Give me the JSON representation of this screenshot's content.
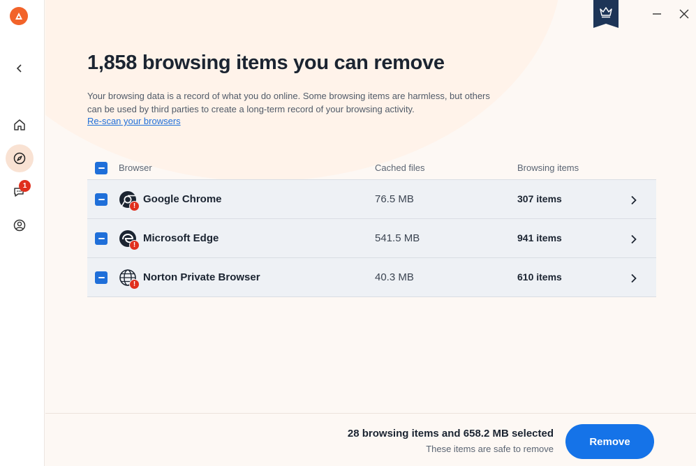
{
  "colors": {
    "accent": "#1573e8",
    "brand": "#f2632a",
    "warning": "#e0301e",
    "highlight": "#f09c86"
  },
  "sidebar": {
    "items": [
      {
        "name": "back",
        "icon": "chevron-left-icon"
      },
      {
        "name": "home",
        "icon": "home-icon"
      },
      {
        "name": "browse",
        "icon": "compass-icon",
        "active": true
      },
      {
        "name": "messages",
        "icon": "chat-icon",
        "badge": "1"
      },
      {
        "name": "account",
        "icon": "user-icon"
      }
    ],
    "badge_count": "1"
  },
  "header": {
    "title_highlight": "1,858 browsing items",
    "title_rest": " you can remove",
    "description": "Your browsing data is a record of what you do online. Some browsing items are harmless, but others can be used by third parties to create a long-term record of your browsing activity.",
    "rescan_link": "Re-scan your browsers"
  },
  "table": {
    "columns": [
      "Browser",
      "Cached files",
      "Browsing items"
    ],
    "rows": [
      {
        "browser": "Google Chrome",
        "icon": "chrome-icon",
        "cached": "76.5 MB",
        "items": "307 items"
      },
      {
        "browser": "Microsoft Edge",
        "icon": "edge-icon",
        "cached": "541.5 MB",
        "items": "941 items"
      },
      {
        "browser": "Norton Private Browser",
        "icon": "globe-icon",
        "cached": "40.3 MB",
        "items": "610 items"
      }
    ],
    "warn_glyph": "!"
  },
  "footer": {
    "summary": "28 browsing items and 658.2 MB selected",
    "note": "These items are safe to remove",
    "remove_label": "Remove"
  }
}
